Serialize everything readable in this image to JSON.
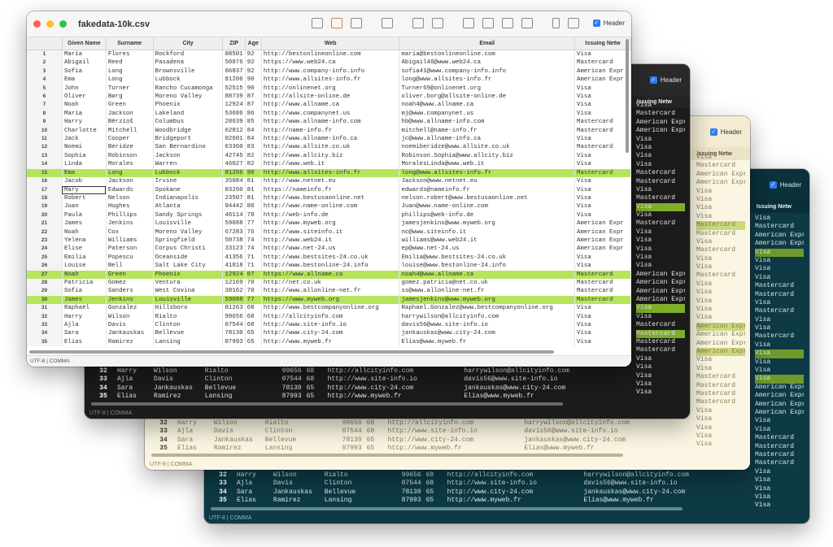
{
  "window": {
    "title": "fakedata-10k.csv"
  },
  "header_toggle_label": "Header",
  "status_text": "UTF-8 | COMMA",
  "columns": [
    "",
    "Given Name",
    "Surname",
    "City",
    "ZIP",
    "Age",
    "Web",
    "Email",
    "Issuing Netw"
  ],
  "rows": [
    [
      "1",
      "Maria",
      "Flores",
      "Rockford",
      "08501",
      "92",
      "http://bestonlineonline.com",
      "maria@bestonlineonline.com",
      "Visa"
    ],
    [
      "2",
      "Abigail",
      "Reed",
      "Pasadena",
      "50876",
      "92",
      "https://www.web24.ca",
      "Abigail46@www.web24.ca",
      "Mastercard"
    ],
    [
      "3",
      "Sofia",
      "Long",
      "Brownsville",
      "06837",
      "92",
      "http://www.company-info.info",
      "sofia41@www.company-info.info",
      "American Expr"
    ],
    [
      "4",
      "Ema",
      "Long",
      "Lubbock",
      "81206",
      "90",
      "http://www.allsites-info.fr",
      "long@www.allsites-info.fr",
      "American Expr"
    ],
    [
      "5",
      "John",
      "Turner",
      "Rancho Cucamonga",
      "52515",
      "90",
      "http://onlinenet.org",
      "Turner69@onlinenet.org",
      "Visa"
    ],
    [
      "6",
      "Oliver",
      "Børg",
      "Moreno Valley",
      "88739",
      "87",
      "http://allsite-online.de",
      "oliver.borg@allsite-online.de",
      "Visa"
    ],
    [
      "7",
      "Noah",
      "Green",
      "Phoenix",
      "12924",
      "87",
      "http://www.allname.ca",
      "noah4@www.allname.ca",
      "Visa"
    ],
    [
      "8",
      "Maria",
      "Jackson",
      "Lakeland",
      "53686",
      "86",
      "http://www.companynet.us",
      "mj@www.companynet.us",
      "Visa"
    ],
    [
      "9",
      "Harry",
      "Bērziņš",
      "Columbus",
      "28639",
      "85",
      "http://www.allname-info.com",
      "hb@www.allname-info.com",
      "Mastercard"
    ],
    [
      "10",
      "Charlotte",
      "Mitchell",
      "Woodbridge",
      "62812",
      "84",
      "http://name-info.fr",
      "mitchell@name-info.fr",
      "Mastercard"
    ],
    [
      "11",
      "Jack",
      "Cooper",
      "Bridgeport",
      "02601",
      "84",
      "http://www.allname-info.ca",
      "jc@www.allname-info.ca",
      "Visa"
    ],
    [
      "12",
      "Noemi",
      "Beridze",
      "San Bernardino",
      "63360",
      "83",
      "http://www.allsite.co.uk",
      "noemiberidze@www.allsite.co.uk",
      "Mastercard"
    ],
    [
      "13",
      "Sophia",
      "Robinson",
      "Jackson",
      "42745",
      "82",
      "http://www.allcity.biz",
      "Robinson.Sophia@www.allcity.biz",
      "Visa"
    ],
    [
      "14",
      "Linda",
      "Morales",
      "Warren",
      "46027",
      "82",
      "http://www.web.it",
      "MoralesLinda@www.web.it",
      "Visa"
    ],
    [
      "15",
      "Ema",
      "Long",
      "Lubbock",
      "81206",
      "90",
      "http://www.allsites-info.fr",
      "long@www.allsites-info.fr",
      "Mastercard"
    ],
    [
      "16",
      "Jacob",
      "Jackson",
      "Irvine",
      "35084",
      "81",
      "http://www.netnet.eu",
      "Jackson@www.netnet.eu",
      "Visa"
    ],
    [
      "17",
      "Mary",
      "Edwards",
      "Spokane",
      "03260",
      "81",
      "https://nameinfo.fr",
      "edwards@nameinfo.fr",
      "Visa"
    ],
    [
      "18",
      "Robert",
      "Nelson",
      "Indianapolis",
      "23507",
      "81",
      "http://www.bestusaonline.net",
      "nelson.robert@www.bestusaonline.net",
      "Visa"
    ],
    [
      "19",
      "Juan",
      "Hughes",
      "Atlanta",
      "94442",
      "80",
      "http://www.name-online.com",
      "Juan@www.name-online.com",
      "Visa"
    ],
    [
      "20",
      "Paula",
      "Phillips",
      "Sandy Springs",
      "46114",
      "78",
      "http://web-info.de",
      "phillips@web-info.de",
      "Visa"
    ],
    [
      "21",
      "James",
      "Jenkins",
      "Louisville",
      "59088",
      "77",
      "http://www.myweb.org",
      "jamesjenkins@www.myweb.org",
      "American Expr"
    ],
    [
      "22",
      "Noah",
      "Cox",
      "Moreno Valley",
      "67283",
      "76",
      "http://www.siteinfo.it",
      "nc@www.siteinfo.it",
      "American Expr"
    ],
    [
      "23",
      "Yelena",
      "Williams",
      "Springfield",
      "50738",
      "74",
      "http://www.web24.it",
      "williams@www.web24.it",
      "American Expr"
    ],
    [
      "24",
      "Elise",
      "Paterson",
      "Corpus Christi",
      "33123",
      "74",
      "http://www.net-24.us",
      "ep@www.net-24.us",
      "American Expr"
    ],
    [
      "25",
      "Emilia",
      "Popescu",
      "Oceanside",
      "41356",
      "71",
      "http://www.bestsites-24.co.uk",
      "Emilia@www.bestsites-24.co.uk",
      "Visa"
    ],
    [
      "26",
      "Louise",
      "Bell",
      "Salt Lake City",
      "41818",
      "71",
      "http://www.bestonline-24.info",
      "louise@www.bestonline-24.info",
      "Visa"
    ],
    [
      "27",
      "Noah",
      "Green",
      "Phoenix",
      "12924",
      "87",
      "https://www.allname.ca",
      "noah4@www.allname.ca",
      "Mastercard"
    ],
    [
      "28",
      "Patricia",
      "Gomez",
      "Ventura",
      "12169",
      "70",
      "http://net.co.uk",
      "gomez.patricia@net.co.uk",
      "Mastercard"
    ],
    [
      "29",
      "Sofia",
      "Sanders",
      "West Covina",
      "38162",
      "70",
      "http://www.allonline-net.fr",
      "ss@www.allonline-net.fr",
      "Mastercard"
    ],
    [
      "30",
      "James",
      "Jenkins",
      "Louisville",
      "59088",
      "77",
      "https://www.myweb.org",
      "jamesjenkins@www.myweb.org",
      "Mastercard"
    ],
    [
      "31",
      "Raphaël",
      "Gonzalez",
      "Hillsboro",
      "81263",
      "68",
      "http://www.bestcompanyonline.org",
      "Raphael.Gonzalez@www.bestcompanyonline.org",
      "Visa"
    ],
    [
      "32",
      "Harry",
      "Wilson",
      "Rialto",
      "99656",
      "68",
      "http://allcityinfo.com",
      "harrywilson@allcityinfo.com",
      "Visa"
    ],
    [
      "33",
      "Ajla",
      "Davis",
      "Clinton",
      "07544",
      "68",
      "http://www.site-info.io",
      "davis56@www.site-info.io",
      "Visa"
    ],
    [
      "34",
      "Sara",
      "Jankauskas",
      "Bellevue",
      "78130",
      "65",
      "http://www.city-24.com",
      "jankauskas@www.city-24.com",
      "Visa"
    ],
    [
      "35",
      "Elias",
      "Ramirez",
      "Lansing",
      "87993",
      "65",
      "http://www.myweb.fr",
      "Elias@www.myweb.fr",
      "Visa"
    ]
  ],
  "highlight_rows": [
    15,
    27,
    30
  ],
  "selected_cell_row": 17,
  "back_network_col": [
    "Visa",
    "Mastercard",
    "American Expr",
    "American Expr",
    "Visa",
    "Visa",
    "Visa",
    "Visa",
    "Mastercard",
    "Mastercard",
    "Visa",
    "Mastercard",
    "Visa",
    "Visa",
    "Mastercard",
    "Visa",
    "Visa",
    "Visa",
    "Visa",
    "Visa",
    "American Expr",
    "American Expr",
    "American Expr",
    "American Expr",
    "Visa",
    "Visa",
    "Mastercard",
    "Mastercard",
    "Mastercard",
    "Mastercard",
    "Visa",
    "Visa",
    "Visa",
    "Visa",
    "Visa"
  ],
  "colors": {
    "highlight_light": "#b5e55b",
    "highlight_dark": "#7fae2a",
    "dark_bg": "#1b1b1b",
    "cream_bg": "#fbf6e3",
    "teal_bg": "#0d3a45"
  }
}
